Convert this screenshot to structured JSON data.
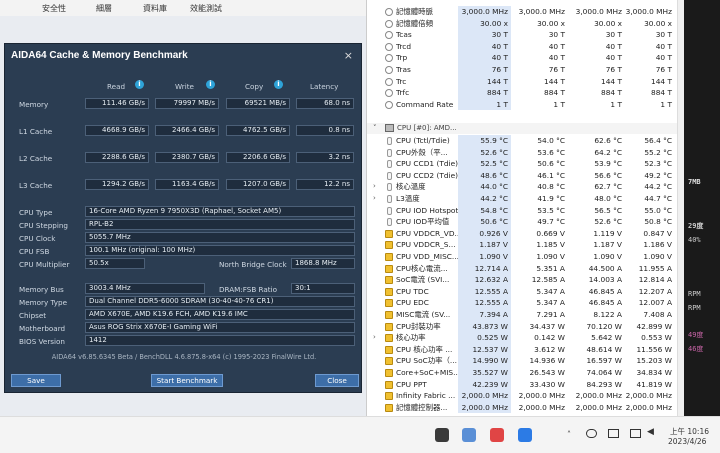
{
  "bg_tabs": [
    "安全性",
    "細層",
    "資料庫",
    "效能測試"
  ],
  "right_strip": [
    "7MB",
    "29度",
    "40%",
    "RPM",
    "RPM",
    "49度",
    "46度"
  ],
  "aida": {
    "title": "AIDA64 Cache & Memory Benchmark",
    "close_x": "×",
    "cols": [
      "Read",
      "Write",
      "Copy",
      "Latency"
    ],
    "rows": [
      {
        "label": "Memory",
        "vals": [
          "111.46 GB/s",
          "79997 MB/s",
          "69521 MB/s",
          "68.0 ns"
        ]
      },
      {
        "label": "L1 Cache",
        "vals": [
          "4668.9 GB/s",
          "2466.4 GB/s",
          "4762.5 GB/s",
          "0.8 ns"
        ]
      },
      {
        "label": "L2 Cache",
        "vals": [
          "2288.6 GB/s",
          "2380.7 GB/s",
          "2206.6 GB/s",
          "3.2 ns"
        ]
      },
      {
        "label": "L3 Cache",
        "vals": [
          "1294.2 GB/s",
          "1163.4 GB/s",
          "1207.0 GB/s",
          "12.2 ns"
        ]
      }
    ],
    "cpu_type_label": "CPU Type",
    "cpu_type": "16-Core AMD Ryzen 9 7950X3D  (Raphael, Socket AM5)",
    "cpu_stepping_label": "CPU Stepping",
    "cpu_stepping": "RPL-B2",
    "cpu_clock_label": "CPU Clock",
    "cpu_clock": "5055.7 MHz",
    "cpu_fsb_label": "CPU FSB",
    "cpu_fsb": "100.1 MHz  (original: 100 MHz)",
    "cpu_mult_label": "CPU Multiplier",
    "cpu_mult": "50.5x",
    "nb_clock_label": "North Bridge Clock",
    "nb_clock": "1868.8 MHz",
    "mem_bus_label": "Memory Bus",
    "mem_bus": "3003.4 MHz",
    "dram_ratio_label": "DRAM:FSB Ratio",
    "dram_ratio": "30:1",
    "mem_type_label": "Memory Type",
    "mem_type": "Dual Channel DDR5-6000 SDRAM  (30-40-40-76 CR1)",
    "chipset_label": "Chipset",
    "chipset": "AMD X670E, AMD K19.6 FCH, AMD K19.6 IMC",
    "motherboard_label": "Motherboard",
    "motherboard": "Asus ROG Strix X670E-I Gaming WiFi",
    "bios_label": "BIOS Version",
    "bios": "1412",
    "footer": "AIDA64 v6.85.6345 Beta / BenchDLL 4.6.875.8-x64  (c) 1995-2023 FinalWire Ltd.",
    "save": "Save",
    "start": "Start Benchmark",
    "close": "Close"
  },
  "sensors": {
    "top_rows": [
      {
        "name": "記憶體時脈",
        "v": [
          "3,000.0 MHz",
          "3,000.0 MHz",
          "3,000.0 MHz",
          "3,000.0 MHz"
        ]
      },
      {
        "name": "記憶體倍頻",
        "v": [
          "30.00 x",
          "30.00 x",
          "30.00 x",
          "30.00 x"
        ]
      },
      {
        "name": "Tcas",
        "v": [
          "30 T",
          "30 T",
          "30 T",
          "30 T"
        ]
      },
      {
        "name": "Trcd",
        "v": [
          "40 T",
          "40 T",
          "40 T",
          "40 T"
        ]
      },
      {
        "name": "Trp",
        "v": [
          "40 T",
          "40 T",
          "40 T",
          "40 T"
        ]
      },
      {
        "name": "Tras",
        "v": [
          "76 T",
          "76 T",
          "76 T",
          "76 T"
        ]
      },
      {
        "name": "Trc",
        "v": [
          "144 T",
          "144 T",
          "144 T",
          "144 T"
        ]
      },
      {
        "name": "Trfc",
        "v": [
          "884 T",
          "884 T",
          "884 T",
          "884 T"
        ]
      },
      {
        "name": "Command Rate",
        "v": [
          "1 T",
          "1 T",
          "1 T",
          "1 T"
        ]
      }
    ],
    "section": "CPU [#0]: AMD...",
    "cpu_rows": [
      {
        "name": "CPU (Tctl/Tdie)",
        "v": [
          "55.9 °C",
          "54.0 °C",
          "62.6 °C",
          "56.4 °C"
        ]
      },
      {
        "name": "CPU外殼（平...",
        "v": [
          "52.6 °C",
          "53.6 °C",
          "64.2 °C",
          "55.2 °C"
        ]
      },
      {
        "name": "CPU CCD1 (Tdie)",
        "v": [
          "52.5 °C",
          "50.6 °C",
          "53.9 °C",
          "52.3 °C"
        ]
      },
      {
        "name": "CPU CCD2 (Tdie)",
        "v": [
          "48.6 °C",
          "46.1 °C",
          "56.6 °C",
          "49.2 °C"
        ]
      },
      {
        "name": "核心溫度",
        "v": [
          "44.0 °C",
          "40.8 °C",
          "62.7 °C",
          "44.2 °C"
        ]
      },
      {
        "name": "L3溫度",
        "v": [
          "44.2 °C",
          "41.9 °C",
          "48.0 °C",
          "44.7 °C"
        ]
      },
      {
        "name": "CPU IOD Hotspot",
        "v": [
          "54.8 °C",
          "53.5 °C",
          "56.5 °C",
          "55.0 °C"
        ]
      },
      {
        "name": "CPU IOD平均值",
        "v": [
          "50.6 °C",
          "49.7 °C",
          "52.6 °C",
          "50.8 °C"
        ]
      },
      {
        "name": "CPU VDDCR_VD...",
        "v": [
          "0.926 V",
          "0.669 V",
          "1.119 V",
          "0.847 V"
        ]
      },
      {
        "name": "CPU VDDCR_S...",
        "v": [
          "1.187 V",
          "1.185 V",
          "1.187 V",
          "1.186 V"
        ]
      },
      {
        "name": "CPU VDD_MISC...",
        "v": [
          "1.090 V",
          "1.090 V",
          "1.090 V",
          "1.090 V"
        ]
      },
      {
        "name": "CPU核心電流...",
        "v": [
          "12.714 A",
          "5.351 A",
          "44.500 A",
          "11.955 A"
        ]
      },
      {
        "name": "SoC電流 (SVI...",
        "v": [
          "12.632 A",
          "12.585 A",
          "14.003 A",
          "12.814 A"
        ]
      },
      {
        "name": "CPU TDC",
        "v": [
          "12.555 A",
          "5.347 A",
          "46.845 A",
          "12.207 A"
        ]
      },
      {
        "name": "CPU EDC",
        "v": [
          "12.555 A",
          "5.347 A",
          "46.845 A",
          "12.007 A"
        ]
      },
      {
        "name": "MISC電流 (SV...",
        "v": [
          "7.394 A",
          "7.291 A",
          "8.122 A",
          "7.408 A"
        ]
      },
      {
        "name": "CPU封裝功率",
        "v": [
          "43.873 W",
          "34.437 W",
          "70.120 W",
          "42.899 W"
        ]
      },
      {
        "name": "核心功率",
        "v": [
          "0.525 W",
          "0.142 W",
          "5.642 W",
          "0.553 W"
        ]
      },
      {
        "name": "CPU 核心功率 ...",
        "v": [
          "12.537 W",
          "3.612 W",
          "48.614 W",
          "11.556 W"
        ]
      },
      {
        "name": "CPU SoC功率（...",
        "v": [
          "14.990 W",
          "14.936 W",
          "16.597 W",
          "15.203 W"
        ]
      },
      {
        "name": "Core+SoC+MIS...",
        "v": [
          "35.527 W",
          "26.543 W",
          "74.064 W",
          "34.834 W"
        ]
      },
      {
        "name": "CPU PPT",
        "v": [
          "42.239 W",
          "33.430 W",
          "84.293 W",
          "41.819 W"
        ]
      },
      {
        "name": "Infinity Fabric ...",
        "v": [
          "2,000.0 MHz",
          "2,000.0 MHz",
          "2,000.0 MHz",
          "2,000.0 MHz"
        ]
      },
      {
        "name": "記憶體控制器...",
        "v": [
          "2,000.0 MHz",
          "2,000.0 MHz",
          "2,000.0 MHz",
          "2,000.0 MHz"
        ]
      }
    ]
  },
  "taskbar": {
    "time": "上午 10:16",
    "date": "2023/4/26"
  }
}
